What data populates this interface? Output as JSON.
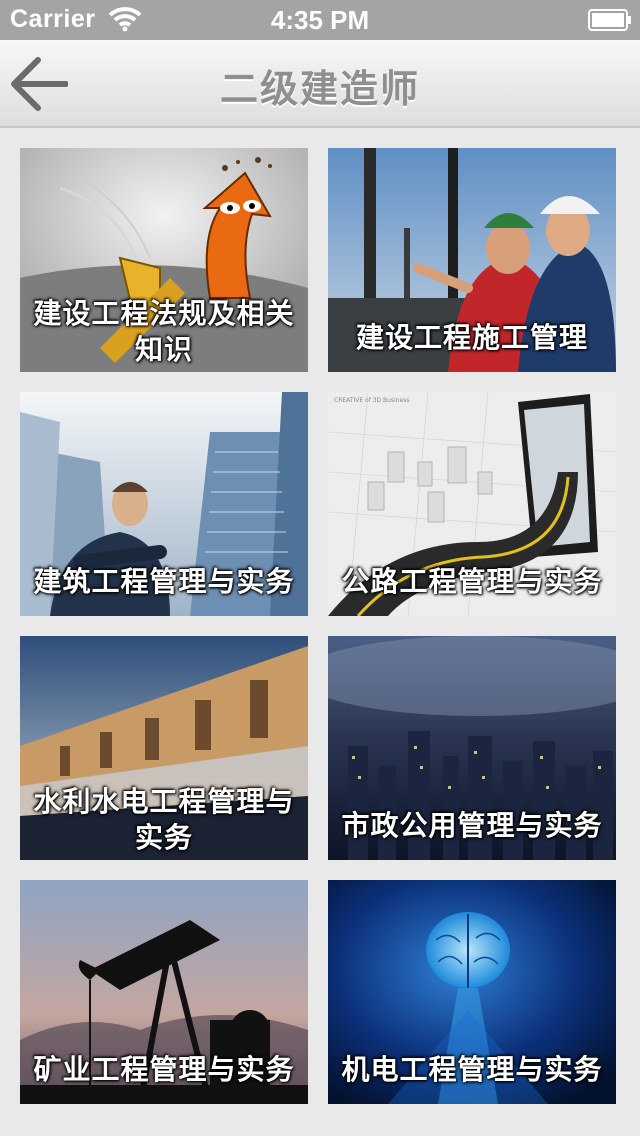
{
  "status_bar": {
    "carrier": "Carrier",
    "time": "4:35 PM",
    "icons": [
      "wifi-icon",
      "battery-icon"
    ]
  },
  "nav": {
    "title": "二级建造师",
    "back_icon": "back-arrow-icon"
  },
  "tiles": [
    {
      "label": "建设工程法规及相关知识",
      "image": "cartoon-arrow-illustration"
    },
    {
      "label": "建设工程施工管理",
      "image": "engineers-hardhats-photo"
    },
    {
      "label": "建筑工程管理与实务",
      "image": "businessman-skyscrapers-photo"
    },
    {
      "label": "公路工程管理与实务",
      "image": "road-into-tablet-illustration"
    },
    {
      "label": "水利水电工程管理与实务",
      "image": "dam-spillway-photo"
    },
    {
      "label": "市政公用管理与实务",
      "image": "city-night-skyline-photo"
    },
    {
      "label": "矿业工程管理与实务",
      "image": "oil-pumpjack-photo"
    },
    {
      "label": "机电工程管理与实务",
      "image": "digital-brain-illustration"
    }
  ],
  "colors": {
    "status_bar": "#a4a4a4",
    "nav_title": "#8f8f8f",
    "background": "#e9e9e9"
  }
}
